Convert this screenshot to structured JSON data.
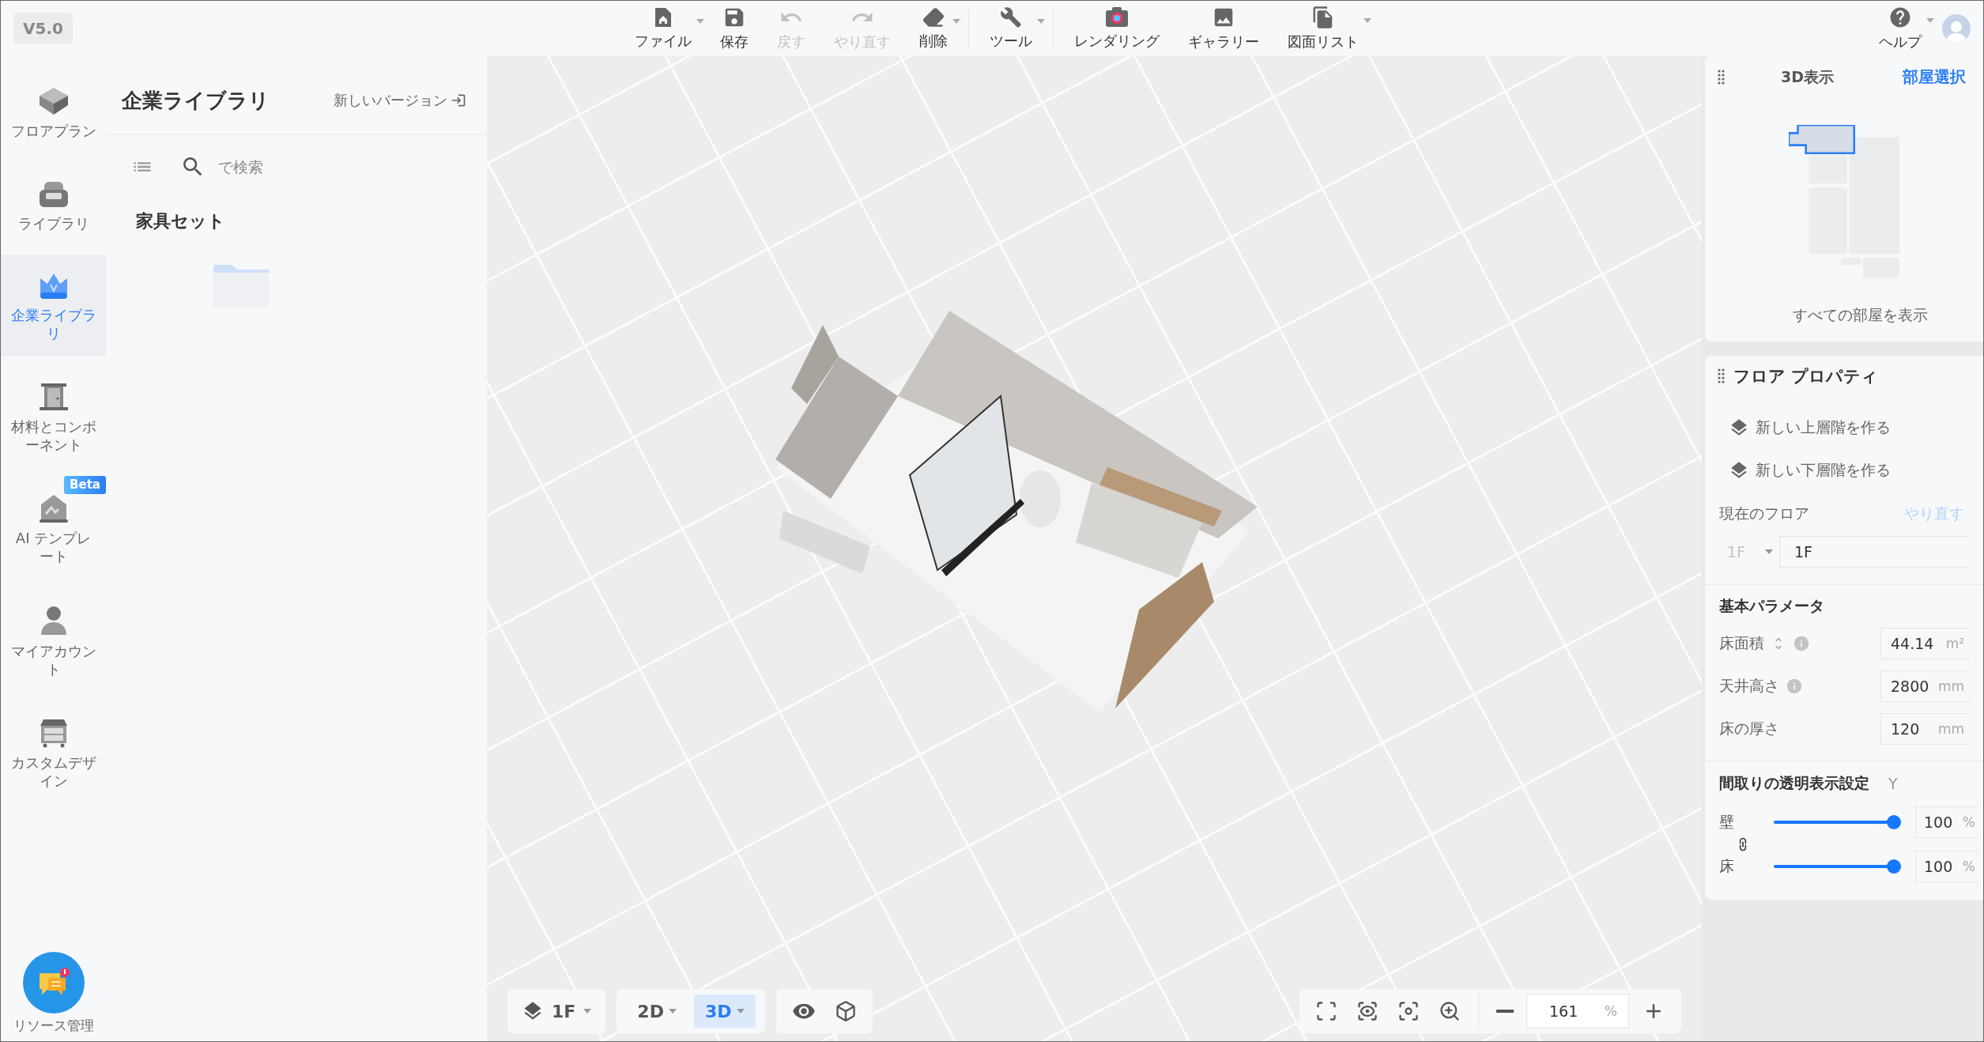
{
  "version": "V5.0",
  "toolbar": [
    {
      "label": "ファイル",
      "disabled": false,
      "dropdown": true
    },
    {
      "label": "保存",
      "disabled": false,
      "dropdown": false
    },
    {
      "label": "戻す",
      "disabled": true,
      "dropdown": false
    },
    {
      "label": "やり直す",
      "disabled": true,
      "dropdown": false
    },
    {
      "label": "削除",
      "disabled": false,
      "dropdown": true
    },
    {
      "label": "ツール",
      "disabled": false,
      "dropdown": true
    },
    {
      "label": "レンダリング",
      "disabled": false,
      "dropdown": false
    },
    {
      "label": "ギャラリー",
      "disabled": false,
      "dropdown": false
    },
    {
      "label": "図面リスト",
      "disabled": false,
      "dropdown": true
    }
  ],
  "help": {
    "label": "ヘルプ"
  },
  "nav": [
    {
      "label": "フロアプラン",
      "selected": false
    },
    {
      "label": "ライブラリ",
      "selected": false
    },
    {
      "label": "企業ライブラリ",
      "selected": true
    },
    {
      "label": "材料とコンポーネント",
      "selected": false
    },
    {
      "label": "AI テンプレート",
      "selected": false,
      "badge": "Beta"
    },
    {
      "label": "マイアカウント",
      "selected": false
    },
    {
      "label": "カスタムデザイン",
      "selected": false
    }
  ],
  "nav_footer": {
    "label": "リソース管理"
  },
  "library": {
    "title": "企業ライブラリ",
    "new_version": "新しいバージョン",
    "search": {
      "placeholder": "で検索"
    },
    "section": "家具セット"
  },
  "canvas": {
    "floor": "1F",
    "modes": [
      {
        "label": "2D",
        "selected": false
      },
      {
        "label": "3D",
        "selected": true
      }
    ],
    "zoom": {
      "value": "161",
      "unit": "%"
    }
  },
  "view_panel": {
    "title": "3D表示",
    "room_select": "部屋選択",
    "show_all": "すべての部屋を表示"
  },
  "floor_panel": {
    "title": "フロア プロパティ",
    "actions": [
      "新しい上層階を作る",
      "新しい下層階を作る"
    ],
    "current_floor": {
      "label": "現在のフロア",
      "redo": "やり直す",
      "redo_disabled": true,
      "select": "1F",
      "select_disabled": true,
      "value": "1F"
    },
    "basic": {
      "title": "基本パラメータ",
      "rows": [
        {
          "label": "床面積",
          "info": true,
          "sort": true,
          "value": "44.14",
          "unit": "m²"
        },
        {
          "label": "天井高さ",
          "info": true,
          "sort": false,
          "value": "2800",
          "unit": "mm"
        },
        {
          "label": "床の厚さ",
          "info": false,
          "sort": false,
          "value": "120",
          "unit": "mm"
        }
      ]
    },
    "transparency": {
      "title": "間取りの透明表示設定",
      "hint": "Y",
      "sliders": [
        {
          "label": "壁",
          "level": 1,
          "value": "100",
          "unit": "%"
        },
        {
          "label": "床",
          "level": 1,
          "value": "100",
          "unit": "%"
        }
      ]
    }
  }
}
